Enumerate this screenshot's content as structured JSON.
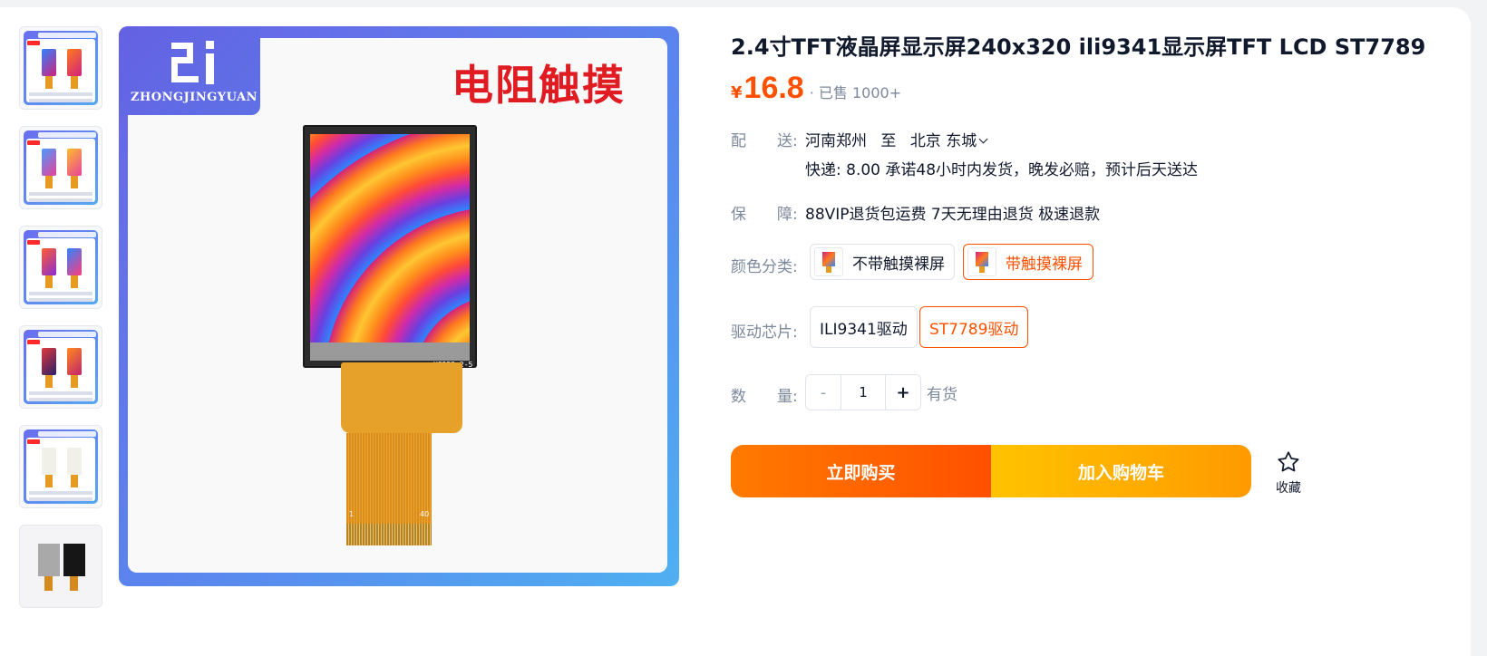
{
  "product": {
    "title": "2.4寸TFT液晶屏显示屏240x320 ili9341显示屏TFT LCD ST7789",
    "currency": "¥",
    "price": "16.8",
    "sold": "· 已售 1000+"
  },
  "gallery": {
    "brand": "ZHONGJINGYUAN",
    "touch_label": "电阻触摸",
    "lcd_code": "HS252   2-5",
    "pin_first": "1",
    "pin_last": "40"
  },
  "shipping": {
    "label": "配　　送:",
    "from": "河南郑州",
    "to_word": "至",
    "dest": "北京 东城",
    "detail": "快递: 8.00  承诺48小时内发货，晚发必赔，预计后天送达"
  },
  "guarantee": {
    "label": "保　　障:",
    "text": "88VIP退货包运费 7天无理由退货 极速退款"
  },
  "color": {
    "label": "颜色分类:",
    "options": [
      "不带触摸裸屏",
      "带触摸裸屏"
    ]
  },
  "driver": {
    "label": "驱动芯片:",
    "options": [
      "ILI9341驱动",
      "ST7789驱动"
    ]
  },
  "quantity": {
    "label": "数　　量:",
    "minus": "-",
    "value": "1",
    "plus": "+",
    "stock": "有货"
  },
  "actions": {
    "buy": "立即购买",
    "cart": "加入购物车",
    "favorite": "收藏"
  },
  "colors": {
    "accent": "#ff5000",
    "label_gray": "#7c889c"
  }
}
